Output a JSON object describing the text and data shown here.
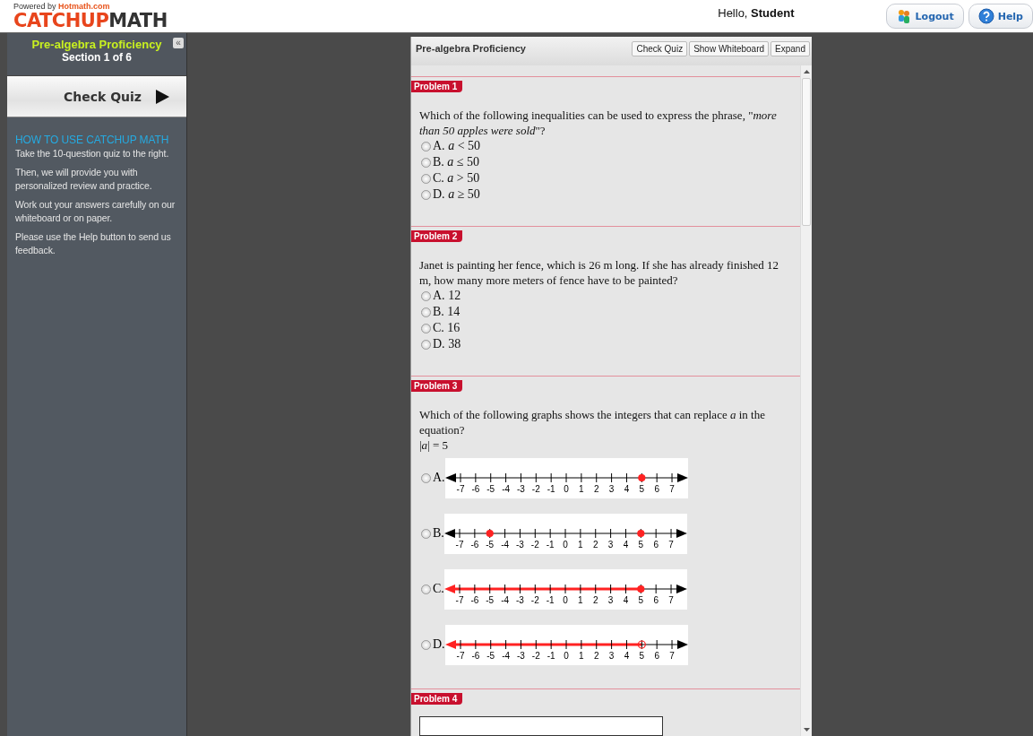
{
  "header": {
    "powered_by": "Powered by",
    "powered_site": "Hotmath.com",
    "logo_first": "CATCHUP",
    "logo_second": "MATH",
    "greeting": "Hello,",
    "user": "Student",
    "buttons": [
      {
        "label": "Logout",
        "kind": "logout"
      },
      {
        "label": "Help",
        "kind": "help"
      }
    ]
  },
  "sidebar": {
    "title": "Pre-algebra Proficiency",
    "section": "Section 1 of 6",
    "collapse": "«",
    "action": "Check Quiz",
    "help_title": "HOW TO USE CATCHUP MATH",
    "help_paragraphs": [
      "Take the 10-question quiz to the right.",
      "Then, we will provide you with personalized review and practice.",
      "Work out your answers carefully on our whiteboard or on paper.",
      "Please use the Help button to send us feedback."
    ]
  },
  "quiz": {
    "title": "Pre-algebra Proficiency",
    "buttons": [
      "Check Quiz",
      "Show Whiteboard",
      "Expand"
    ],
    "problems": [
      {
        "tag": "Problem 1",
        "kind": "choice",
        "question": "Which of the following inequalities can be used to express the phrase, \"*more than 50 apples were sold*\"?",
        "options": [
          {
            "letter": "A.",
            "text": "*a* < 50",
            "selected": false
          },
          {
            "letter": "B.",
            "text": "*a* ≤ 50",
            "selected": false
          },
          {
            "letter": "C.",
            "text": "*a* > 50",
            "selected": false
          },
          {
            "letter": "D.",
            "text": "*a* ≥ 50",
            "selected": false
          }
        ]
      },
      {
        "tag": "Problem 2",
        "kind": "choice",
        "question": "Janet is painting her fence, which is 26 m long. If she has already finished 12 m, how many more meters of fence have to be painted?",
        "options": [
          {
            "letter": "A.",
            "text": "12",
            "selected": false
          },
          {
            "letter": "B.",
            "text": "14",
            "selected": false
          },
          {
            "letter": "C.",
            "text": "16",
            "selected": false
          },
          {
            "letter": "D.",
            "text": "38",
            "selected": false
          }
        ]
      },
      {
        "tag": "Problem 3",
        "kind": "graph",
        "question": "Which of the following graphs shows the integers that can replace *a* in the equation?",
        "equation": "|*a*| = 5",
        "options": [
          {
            "letter": "A.",
            "selected": false,
            "ray_left": false,
            "dots_open": false,
            "ticks": [
              {
                "label": "-7",
                "dot": false
              },
              {
                "label": "-6",
                "dot": false
              },
              {
                "label": "-5",
                "dot": false
              },
              {
                "label": "-4",
                "dot": false
              },
              {
                "label": "-3",
                "dot": false
              },
              {
                "label": "-2",
                "dot": false
              },
              {
                "label": "-1",
                "dot": false
              },
              {
                "label": "0",
                "dot": false
              },
              {
                "label": "1",
                "dot": false
              },
              {
                "label": "2",
                "dot": false
              },
              {
                "label": "3",
                "dot": false
              },
              {
                "label": "4",
                "dot": false
              },
              {
                "label": "5",
                "dot": true
              },
              {
                "label": "6",
                "dot": false
              },
              {
                "label": "7",
                "dot": false
              }
            ]
          },
          {
            "letter": "B.",
            "selected": false,
            "ray_left": false,
            "dots_open": false,
            "ticks": [
              {
                "label": "-7",
                "dot": false
              },
              {
                "label": "-6",
                "dot": false
              },
              {
                "label": "-5",
                "dot": true
              },
              {
                "label": "-4",
                "dot": false
              },
              {
                "label": "-3",
                "dot": false
              },
              {
                "label": "-2",
                "dot": false
              },
              {
                "label": "-1",
                "dot": false
              },
              {
                "label": "0",
                "dot": false
              },
              {
                "label": "1",
                "dot": false
              },
              {
                "label": "2",
                "dot": false
              },
              {
                "label": "3",
                "dot": false
              },
              {
                "label": "4",
                "dot": false
              },
              {
                "label": "5",
                "dot": true
              },
              {
                "label": "6",
                "dot": false
              },
              {
                "label": "7",
                "dot": false
              }
            ]
          },
          {
            "letter": "C.",
            "selected": false,
            "ray_left": true,
            "dots_open": false,
            "ticks": [
              {
                "label": "-7",
                "dot": false
              },
              {
                "label": "-6",
                "dot": false
              },
              {
                "label": "-5",
                "dot": false
              },
              {
                "label": "-4",
                "dot": false
              },
              {
                "label": "-3",
                "dot": false
              },
              {
                "label": "-2",
                "dot": false
              },
              {
                "label": "-1",
                "dot": false
              },
              {
                "label": "0",
                "dot": false
              },
              {
                "label": "1",
                "dot": false
              },
              {
                "label": "2",
                "dot": false
              },
              {
                "label": "3",
                "dot": false
              },
              {
                "label": "4",
                "dot": false
              },
              {
                "label": "5",
                "dot": true
              },
              {
                "label": "6",
                "dot": false
              },
              {
                "label": "7",
                "dot": false
              }
            ]
          },
          {
            "letter": "D.",
            "selected": false,
            "ray_left": true,
            "dots_open": true,
            "ticks": [
              {
                "label": "-7",
                "dot": false
              },
              {
                "label": "-6",
                "dot": false
              },
              {
                "label": "-5",
                "dot": false
              },
              {
                "label": "-4",
                "dot": false
              },
              {
                "label": "-3",
                "dot": false
              },
              {
                "label": "-2",
                "dot": false
              },
              {
                "label": "-1",
                "dot": false
              },
              {
                "label": "0",
                "dot": false
              },
              {
                "label": "1",
                "dot": false
              },
              {
                "label": "2",
                "dot": false
              },
              {
                "label": "3",
                "dot": false
              },
              {
                "label": "4",
                "dot": false
              },
              {
                "label": "5",
                "dot": true
              },
              {
                "label": "6",
                "dot": false
              },
              {
                "label": "7",
                "dot": false
              }
            ]
          }
        ]
      },
      {
        "tag": "Problem 4",
        "kind": "input"
      }
    ]
  }
}
